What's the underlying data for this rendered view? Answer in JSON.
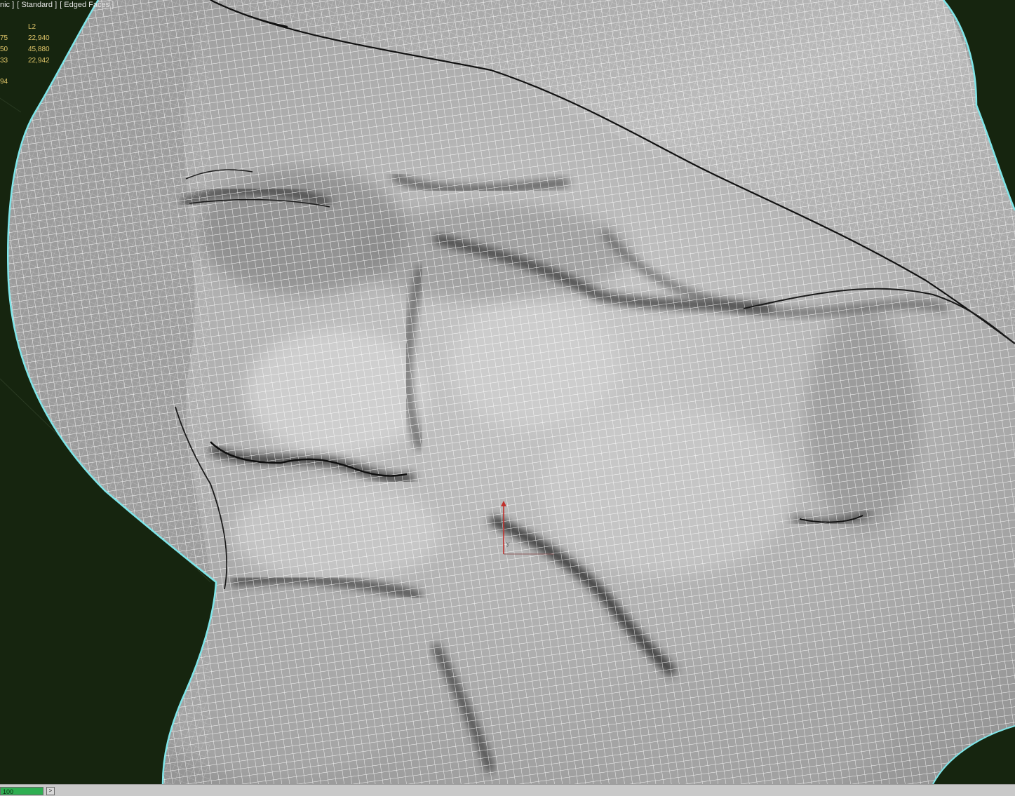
{
  "viewport": {
    "label_parts": [
      "nic ]",
      "[ Standard ]",
      "[ Edged Faces ]"
    ],
    "background": "#16250f",
    "selection_outline_color": "#7fe6ea"
  },
  "stats": {
    "header": "L2",
    "rows": [
      {
        "c1": "75",
        "c2": "22,940"
      },
      {
        "c1": "50",
        "c2": "45,880"
      },
      {
        "c1": "33",
        "c2": "22,942"
      }
    ],
    "extra": "94"
  },
  "statusbar": {
    "time_value": "100",
    "next_icon": "arrow-right-icon"
  }
}
